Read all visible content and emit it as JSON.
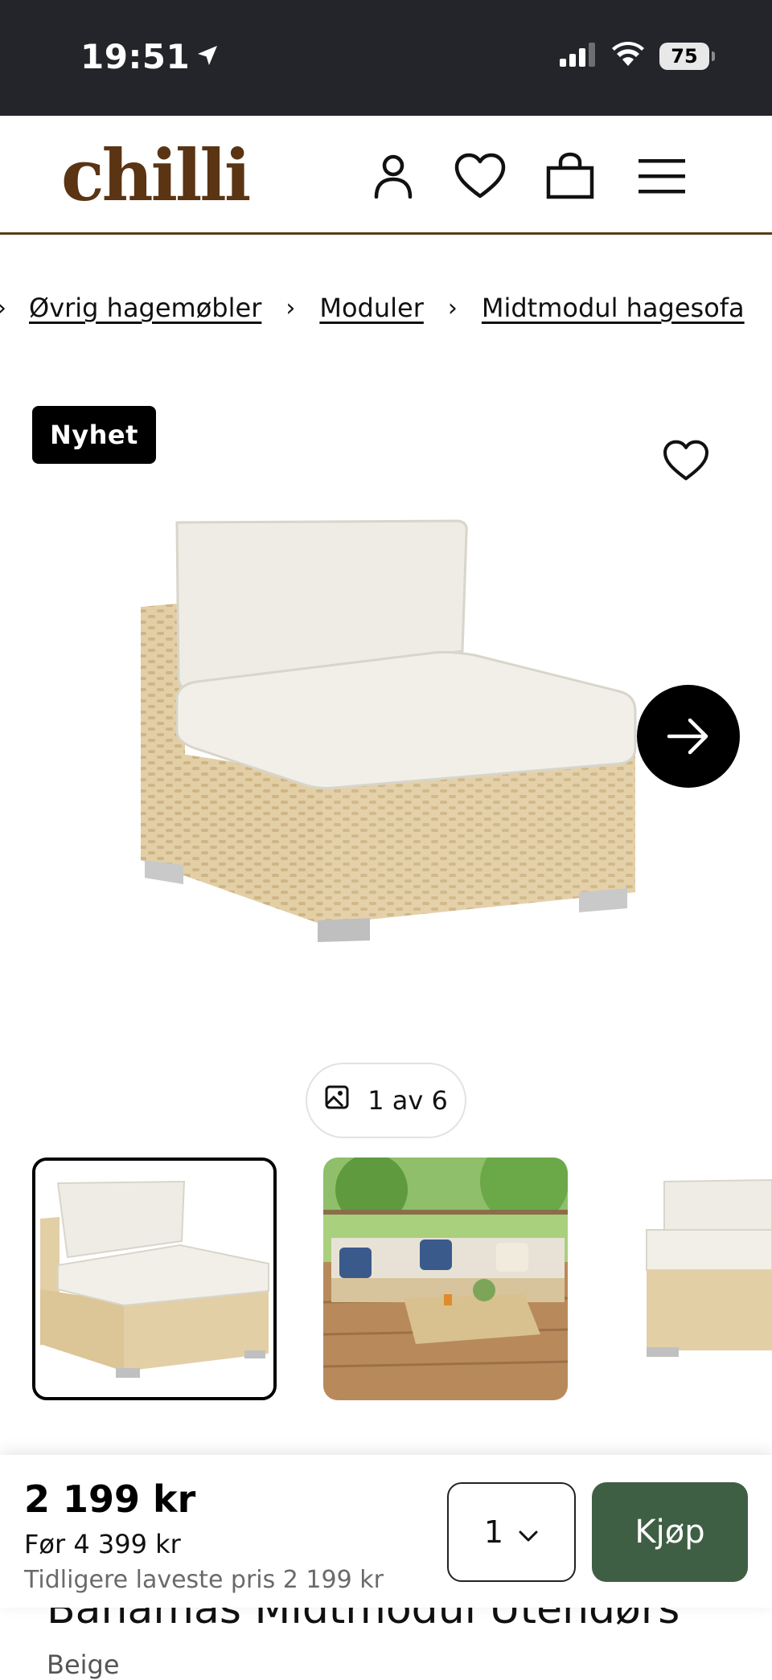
{
  "status_bar": {
    "time": "19:51",
    "battery": "75",
    "icons": [
      "location-arrow-icon",
      "signal-icon",
      "wifi-icon",
      "battery-icon"
    ]
  },
  "header": {
    "logo": "chilli",
    "brand_color": "#5a3413",
    "icons": [
      "user-icon",
      "heart-icon",
      "shopping-bag-icon",
      "menu-icon"
    ]
  },
  "breadcrumb": {
    "items": [
      "Øvrig hagemøbler",
      "Moduler",
      "Midtmodul hagesofa"
    ]
  },
  "product": {
    "badge": "Nyhet",
    "image_counter": "1 av 6",
    "title": "Bahamas Midtmodul Utendørs",
    "color": "Beige"
  },
  "buy_bar": {
    "price": "2 199 kr",
    "old_price": "Før 4 399 kr",
    "lowest_price": "Tidligere laveste pris 2 199 kr",
    "quantity": "1",
    "buy_label": "Kjøp",
    "button_color": "#3f5f45"
  }
}
